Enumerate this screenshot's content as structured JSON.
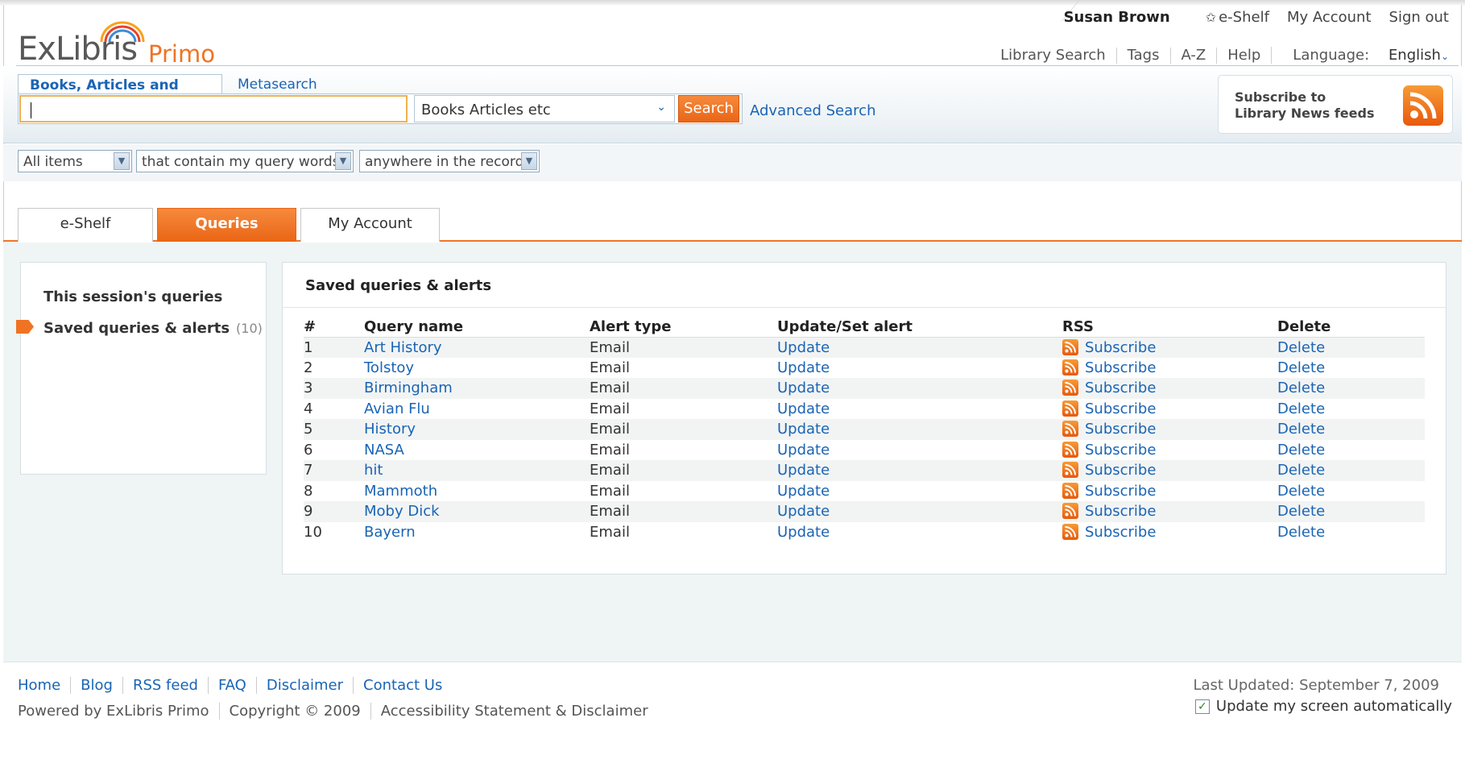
{
  "brand": {
    "logo_ex": "ExLibris",
    "logo_primo": "Primo"
  },
  "user_nav": {
    "username": "Susan Brown",
    "eshelf": "e-Shelf",
    "my_account": "My Account",
    "sign_out": "Sign out"
  },
  "main_nav": {
    "items": [
      "Library Search",
      "Tags",
      "A-Z",
      "Help"
    ],
    "language_label": "Language:",
    "language_value": "English"
  },
  "search": {
    "tabs": [
      "Books, Articles and More",
      "Metasearch"
    ],
    "query_value": "",
    "scope_selected": "Books Articles etc",
    "search_button": "Search",
    "advanced_link": "Advanced Search"
  },
  "rss_promo": {
    "line1": "Subscribe to",
    "line2": "Library News feeds"
  },
  "filters": {
    "material": "All items",
    "precision": "that contain my query words",
    "field": "anywhere in the record"
  },
  "account_tabs": [
    "e-Shelf",
    "Queries",
    "My Account"
  ],
  "active_tab": "Queries",
  "sidebar": {
    "session_queries": "This session's queries",
    "saved_queries": "Saved queries & alerts",
    "saved_count": "(10)"
  },
  "panel": {
    "title": "Saved queries & alerts",
    "columns": [
      "#",
      "Query name",
      "Alert type",
      "Update/Set alert",
      "RSS",
      "Delete"
    ],
    "rows": [
      {
        "num": "1",
        "name": "Art History",
        "alert": "Email",
        "update": "Update",
        "rss": "Subscribe",
        "del": "Delete"
      },
      {
        "num": "2",
        "name": "Tolstoy",
        "alert": "Email",
        "update": "Update",
        "rss": "Subscribe",
        "del": "Delete"
      },
      {
        "num": "3",
        "name": "Birmingham",
        "alert": "Email",
        "update": "Update",
        "rss": "Subscribe",
        "del": "Delete"
      },
      {
        "num": "4",
        "name": "Avian Flu",
        "alert": "Email",
        "update": "Update",
        "rss": "Subscribe",
        "del": "Delete"
      },
      {
        "num": "5",
        "name": "History",
        "alert": "Email",
        "update": "Update",
        "rss": "Subscribe",
        "del": "Delete"
      },
      {
        "num": "6",
        "name": "NASA",
        "alert": "Email",
        "update": "Update",
        "rss": "Subscribe",
        "del": "Delete"
      },
      {
        "num": "7",
        "name": "hit",
        "alert": "Email",
        "update": "Update",
        "rss": "Subscribe",
        "del": "Delete"
      },
      {
        "num": "8",
        "name": "Mammoth",
        "alert": "Email",
        "update": "Update",
        "rss": "Subscribe",
        "del": "Delete"
      },
      {
        "num": "9",
        "name": "Moby Dick",
        "alert": "Email",
        "update": "Update",
        "rss": "Subscribe",
        "del": "Delete"
      },
      {
        "num": "10",
        "name": "Bayern",
        "alert": "Email",
        "update": "Update",
        "rss": "Subscribe",
        "del": "Delete"
      }
    ]
  },
  "footer": {
    "links": [
      "Home",
      "Blog",
      "RSS feed",
      "FAQ",
      "Disclaimer",
      "Contact Us"
    ],
    "info": [
      "Powered by ExLibris Primo",
      "Copyright © 2009",
      "Accessibility Statement & Disclaimer"
    ],
    "last_updated": "Last Updated: September 7, 2009",
    "auto_update": "Update my screen automatically"
  },
  "colors": {
    "accent": "#f07323",
    "link": "#1a64b4",
    "content_bg": "#eff5f5"
  },
  "icons": {
    "rss": "rss-icon",
    "star": "star-icon",
    "dropdown": "chevron-down-icon",
    "marker": "arrow-marker-icon",
    "checkbox": "checkbox-checked-icon"
  }
}
